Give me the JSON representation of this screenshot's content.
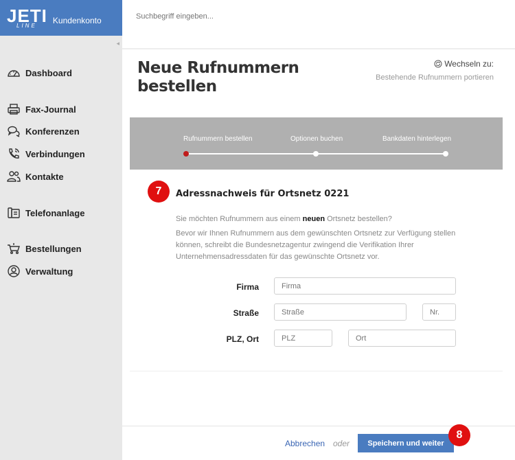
{
  "brand": {
    "logo_top": "JETI",
    "logo_bottom": "LINE",
    "subtitle": "Kundenkonto"
  },
  "search": {
    "placeholder": "Suchbegriff eingeben..."
  },
  "sidebar": {
    "items": [
      {
        "label": "Dashboard",
        "icon": "dashboard-icon"
      },
      {
        "label": "Fax-Journal",
        "icon": "printer-icon"
      },
      {
        "label": "Konferenzen",
        "icon": "chat-icon"
      },
      {
        "label": "Verbindungen",
        "icon": "phone-icon"
      },
      {
        "label": "Kontakte",
        "icon": "contacts-icon"
      },
      {
        "label": "Telefonanlage",
        "icon": "pbx-icon"
      },
      {
        "label": "Bestellungen",
        "icon": "cart-icon"
      },
      {
        "label": "Verwaltung",
        "icon": "user-circle-icon"
      }
    ]
  },
  "header": {
    "title": "Neue Rufnummern bestellen",
    "switch_label": "Wechseln zu:",
    "switch_link": "Bestehende Rufnummern portieren"
  },
  "stepper": {
    "steps": [
      "Rufnummern bestellen",
      "Optionen buchen",
      "Bankdaten hinterlegen"
    ],
    "active_index": 0
  },
  "section": {
    "badge": "7",
    "title": "Adressnachweis für Ortsnetz 0221",
    "q_before": "Sie möchten Rufnummern aus einem ",
    "q_bold": "neuen",
    "q_after": " Ortsnetz bestellen?",
    "info": "Bevor wir Ihnen Rufnummern aus dem gewünschten Ortsnetz zur Verfügung stellen können, schreibt die Bundesnetzagentur zwingend die Verifikation Ihrer Unternehmensadressdaten für das gewünschte Ortsnetz vor."
  },
  "form": {
    "firma_label": "Firma",
    "firma_placeholder": "Firma",
    "strasse_label": "Straße",
    "strasse_placeholder": "Straße",
    "nr_placeholder": "Nr.",
    "plz_label": "PLZ, Ort",
    "plz_placeholder": "PLZ",
    "ort_placeholder": "Ort"
  },
  "footer": {
    "cancel": "Abbrechen",
    "or": "oder",
    "save": "Speichern und weiter",
    "badge": "8"
  },
  "colors": {
    "brand": "#4a7cc0",
    "badge": "#e01010",
    "active_step": "#c01c1c",
    "stepper_bg": "#b0b0b0"
  }
}
